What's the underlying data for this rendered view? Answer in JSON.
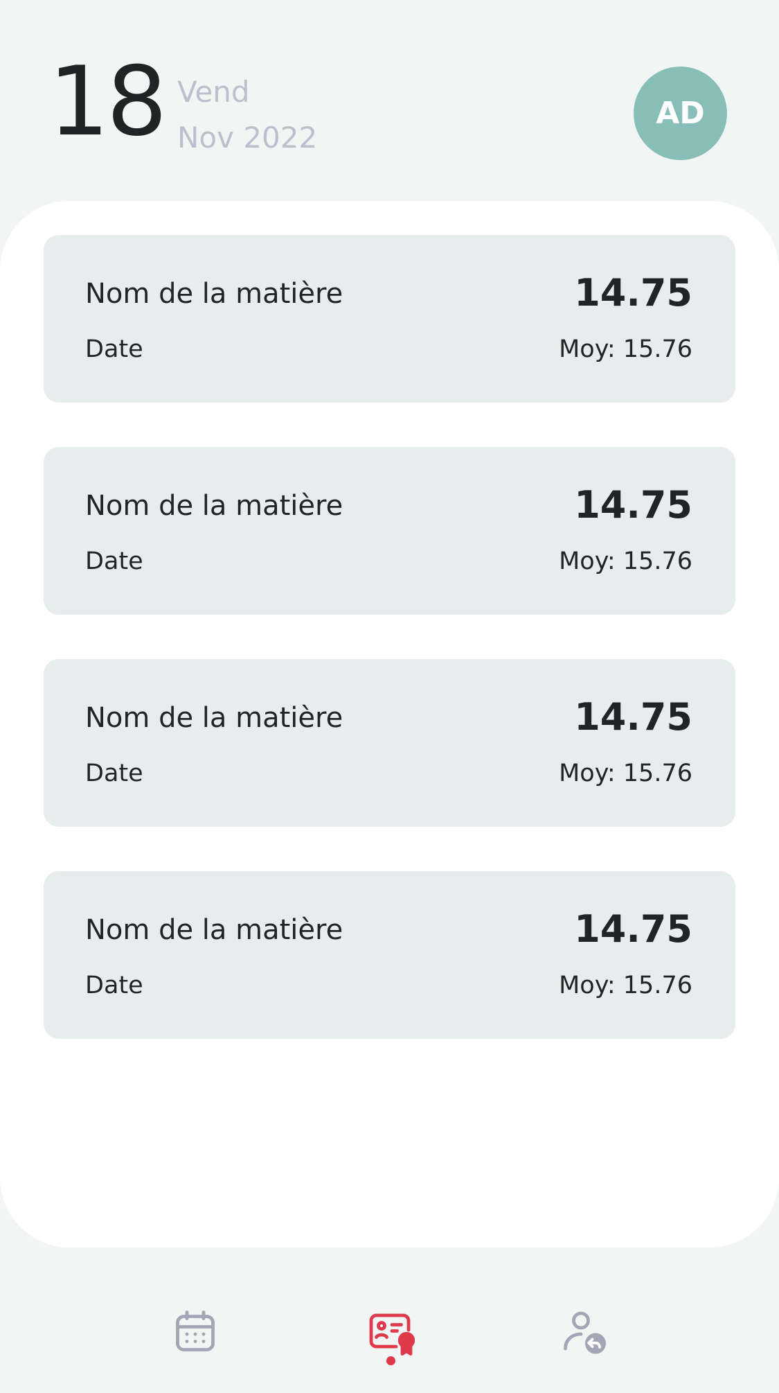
{
  "header": {
    "day_number": "18",
    "weekday": "Vend",
    "month_year": "Nov 2022",
    "avatar_initials": "AD"
  },
  "grades": [
    {
      "subject": "Nom de la matière",
      "grade": "14.75",
      "date": "Date",
      "average": "Moy: 15.76"
    },
    {
      "subject": "Nom de la matière",
      "grade": "14.75",
      "date": "Date",
      "average": "Moy: 15.76"
    },
    {
      "subject": "Nom de la matière",
      "grade": "14.75",
      "date": "Date",
      "average": "Moy: 15.76"
    },
    {
      "subject": "Nom de la matière",
      "grade": "14.75",
      "date": "Date",
      "average": "Moy: 15.76"
    }
  ],
  "nav": {
    "items": [
      {
        "icon": "calendar-icon",
        "active": false
      },
      {
        "icon": "grades-certificate-icon",
        "active": true
      },
      {
        "icon": "user-logout-icon",
        "active": false
      }
    ]
  },
  "colors": {
    "accent": "#df3a4b",
    "inactive_icon": "#a4a6b5",
    "avatar_bg": "#88beb8",
    "card_bg": "#e6eeed",
    "page_bg": "#f1f5f4"
  }
}
